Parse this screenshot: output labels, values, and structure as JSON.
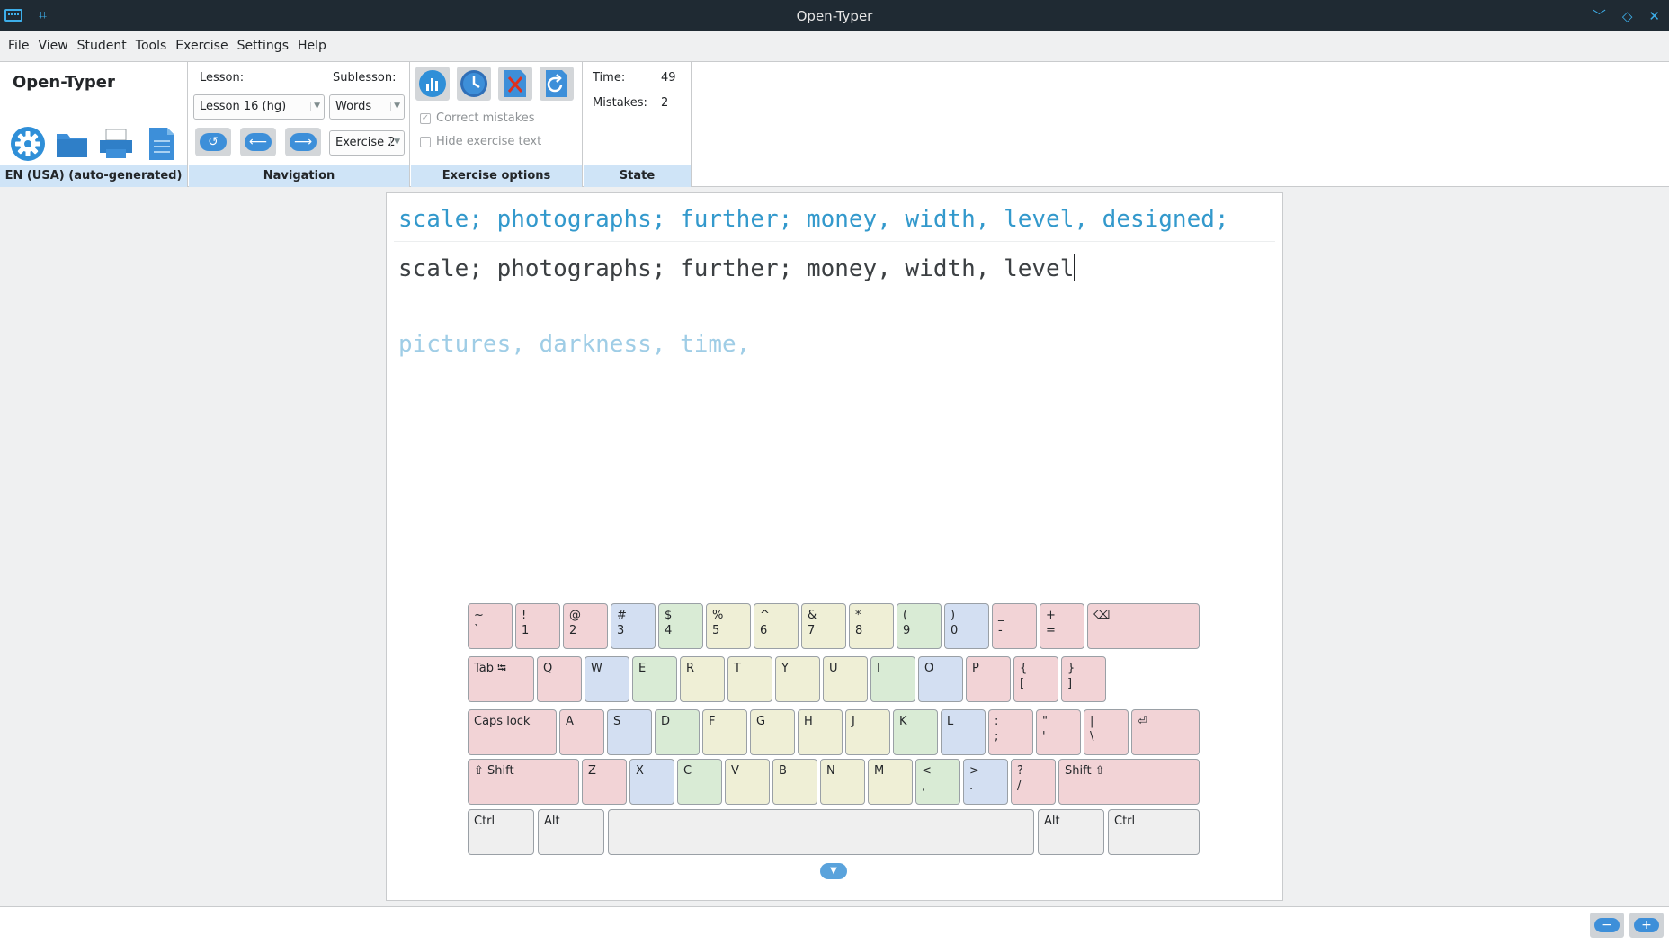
{
  "window": {
    "title": "Open-Typer"
  },
  "menu": [
    "File",
    "View",
    "Student",
    "Tools",
    "Exercise",
    "Settings",
    "Help"
  ],
  "panel": {
    "brand": "Open-Typer",
    "layout_label": "EN (USA) (auto-generated)",
    "navigation": {
      "lesson_label": "Lesson:",
      "lesson_value": "Lesson 16 (hg)",
      "sublesson_label": "Sublesson:",
      "sublesson_value": "Words",
      "exercise_value": "Exercise 2",
      "group_label": "Navigation"
    },
    "exercise_options": {
      "correct_mistakes": "Correct mistakes",
      "correct_mistakes_checked": true,
      "hide_text": "Hide exercise text",
      "hide_text_checked": false,
      "group_label": "Exercise options"
    },
    "state": {
      "time_label": "Time:",
      "time_value": "49",
      "mistakes_label": "Mistakes:",
      "mistakes_value": "2",
      "group_label": "State"
    }
  },
  "exercise": {
    "target_line": "scale; photographs; further; money, width, level, designed;",
    "typed_line": "scale; photographs; further; money, width, level",
    "next_line": "pictures, darkness, time,"
  },
  "keyboard": {
    "row1": [
      {
        "top": "~",
        "bot": "`"
      },
      {
        "top": "!",
        "bot": "1"
      },
      {
        "top": "@",
        "bot": "2"
      },
      {
        "top": "#",
        "bot": "3"
      },
      {
        "top": "$",
        "bot": "4"
      },
      {
        "top": "%",
        "bot": "5"
      },
      {
        "top": "^",
        "bot": "6"
      },
      {
        "top": "&",
        "bot": "7"
      },
      {
        "top": "*",
        "bot": "8"
      },
      {
        "top": "(",
        "bot": "9"
      },
      {
        "top": ")",
        "bot": "0"
      },
      {
        "top": "_",
        "bot": "-"
      },
      {
        "top": "+",
        "bot": "="
      },
      {
        "top": "⌫",
        "bot": ""
      }
    ],
    "row2": [
      {
        "top": "Tab ⭾",
        "bot": ""
      },
      {
        "top": "Q",
        "bot": ""
      },
      {
        "top": "W",
        "bot": ""
      },
      {
        "top": "E",
        "bot": ""
      },
      {
        "top": "R",
        "bot": ""
      },
      {
        "top": "T",
        "bot": ""
      },
      {
        "top": "Y",
        "bot": ""
      },
      {
        "top": "U",
        "bot": ""
      },
      {
        "top": "I",
        "bot": ""
      },
      {
        "top": "O",
        "bot": ""
      },
      {
        "top": "P",
        "bot": ""
      },
      {
        "top": "{",
        "bot": "["
      },
      {
        "top": "}",
        "bot": "]"
      }
    ],
    "row3": [
      {
        "top": "Caps lock",
        "bot": ""
      },
      {
        "top": "A",
        "bot": ""
      },
      {
        "top": "S",
        "bot": ""
      },
      {
        "top": "D",
        "bot": ""
      },
      {
        "top": "F",
        "bot": ""
      },
      {
        "top": "G",
        "bot": ""
      },
      {
        "top": "H",
        "bot": ""
      },
      {
        "top": "J",
        "bot": ""
      },
      {
        "top": "K",
        "bot": ""
      },
      {
        "top": "L",
        "bot": ""
      },
      {
        "top": ":",
        "bot": ";"
      },
      {
        "top": "\"",
        "bot": "'"
      },
      {
        "top": "|",
        "bot": "\\"
      },
      {
        "top": "⏎",
        "bot": ""
      }
    ],
    "row4": [
      {
        "top": "⇧ Shift",
        "bot": ""
      },
      {
        "top": "Z",
        "bot": ""
      },
      {
        "top": "X",
        "bot": ""
      },
      {
        "top": "C",
        "bot": ""
      },
      {
        "top": "V",
        "bot": ""
      },
      {
        "top": "B",
        "bot": ""
      },
      {
        "top": "N",
        "bot": ""
      },
      {
        "top": "M",
        "bot": ""
      },
      {
        "top": "<",
        "bot": ","
      },
      {
        "top": ">",
        "bot": "."
      },
      {
        "top": "?",
        "bot": "/"
      },
      {
        "top": "Shift ⇧",
        "bot": ""
      }
    ],
    "row5": [
      {
        "top": "Ctrl",
        "bot": ""
      },
      {
        "top": "Alt",
        "bot": ""
      },
      {
        "top": "",
        "bot": ""
      },
      {
        "top": "Alt",
        "bot": ""
      },
      {
        "top": "Ctrl",
        "bot": ""
      }
    ]
  },
  "colors": {
    "red": "#f2d3d6",
    "blue": "#d3dff2",
    "green": "#d9ebd5",
    "yellow": "#efefd6",
    "gray": "#efefef",
    "accent": "#3daee9",
    "target_text": "#3399cc",
    "next_text": "#9fcde6"
  },
  "icons": {
    "toolbar": [
      "gear-icon",
      "folder-icon",
      "printer-icon",
      "document-icon"
    ],
    "navigation": [
      "repeat-icon",
      "arrow-left-icon",
      "arrow-right-icon"
    ],
    "exercise": [
      "statistics-icon",
      "clock-icon",
      "delete-icon",
      "revert-icon"
    ]
  }
}
